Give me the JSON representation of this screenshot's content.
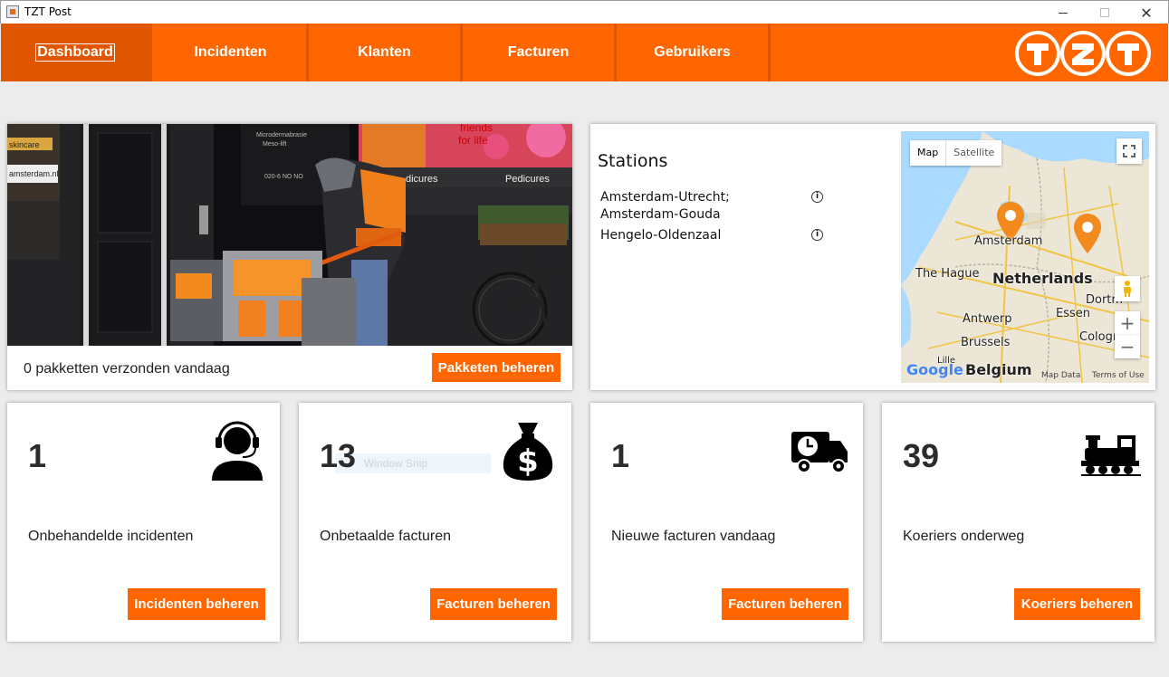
{
  "window": {
    "title": "TZT Post",
    "controls": [
      "minimize",
      "maximize",
      "close"
    ]
  },
  "nav": {
    "items": [
      {
        "label": "Dashboard",
        "active": true
      },
      {
        "label": "Incidenten",
        "active": false
      },
      {
        "label": "Klanten",
        "active": false
      },
      {
        "label": "Facturen",
        "active": false
      },
      {
        "label": "Gebruikers",
        "active": false
      }
    ],
    "logo_text": "TZT",
    "color": "#ff6600",
    "active_color": "#e05500"
  },
  "hero": {
    "caption": "0 pakketten verzonden vandaag",
    "button": "Pakketen beheren",
    "photo_signs": [
      "Microdermabrasie",
      "Meso-lift",
      "020-6 NO NO",
      "friends",
      "for life",
      "dicures",
      "Pedicures",
      "skincare",
      "amsterdam.nl"
    ]
  },
  "stations": {
    "title": "Stations",
    "items": [
      "Amsterdam-Utrecht; Amsterdam-Gouda",
      "Hengelo-Oldenzaal"
    ],
    "map": {
      "type_buttons": [
        "Map",
        "Satellite"
      ],
      "selected_type": "Map",
      "zoom_in": "+",
      "zoom_out": "−",
      "labels": [
        "Amsterdam",
        "The Hague",
        "Netherlands",
        "Antwerp",
        "Essen",
        "Dortm",
        "Brussels",
        "Cologne",
        "Belgium",
        "Lille"
      ],
      "footer": [
        "Map Data",
        "Terms of Use"
      ],
      "logo": "Google"
    }
  },
  "stats": [
    {
      "value": "1",
      "label": "Onbehandelde incidenten",
      "button": "Incidenten beheren",
      "icon": "support-agent-icon"
    },
    {
      "value": "13",
      "label": "Onbetaalde facturen",
      "button": "Facturen beheren",
      "icon": "money-bag-icon"
    },
    {
      "value": "1",
      "label": "Nieuwe facturen vandaag",
      "button": "Facturen beheren",
      "icon": "delivery-truck-icon"
    },
    {
      "value": "39",
      "label": "Koeriers onderweg",
      "button": "Koeriers beheren",
      "icon": "train-icon"
    }
  ],
  "overlay": {
    "snip_text": "Window Snip"
  },
  "colors": {
    "accent": "#ff6600",
    "background": "#ececec"
  }
}
